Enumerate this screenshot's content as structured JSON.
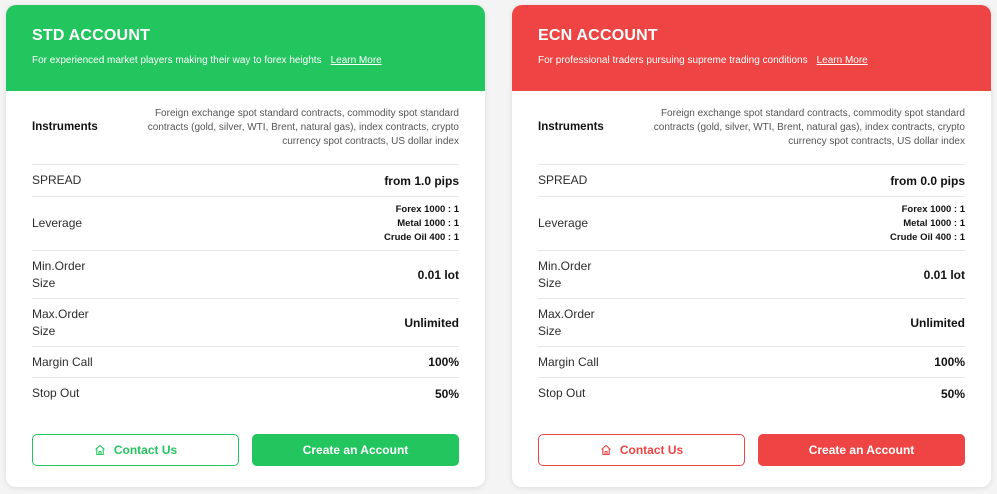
{
  "colors": {
    "std_accent": "#22c55e",
    "ecn_accent": "#ef4444"
  },
  "std": {
    "title": "STD ACCOUNT",
    "subtitle": "For experienced market players making their way to forex heights",
    "learn_more": "Learn More",
    "rows": {
      "instruments": {
        "label": "Instruments",
        "value": "Foreign exchange spot standard contracts, commodity spot standard contracts (gold, silver, WTI, Brent, natural gas), index contracts, crypto currency spot contracts, US dollar index"
      },
      "spread": {
        "label": "SPREAD",
        "value": "from 1.0 pips"
      },
      "leverage": {
        "label": "Leverage",
        "values": [
          "Forex 1000 : 1",
          "Metal 1000 : 1",
          "Crude Oil 400 : 1"
        ]
      },
      "min_order": {
        "label_1": "Min.Order",
        "label_2": "Size",
        "value": "0.01 lot"
      },
      "max_order": {
        "label_1": "Max.Order",
        "label_2": "Size",
        "value": "Unlimited"
      },
      "margin_call": {
        "label": "Margin Call",
        "value": "100%"
      },
      "stop_out": {
        "label": "Stop Out",
        "value": "50%"
      }
    },
    "contact_label": "Contact Us",
    "create_label": "Create an Account"
  },
  "ecn": {
    "title": "ECN ACCOUNT",
    "subtitle": "For professional traders pursuing supreme trading conditions",
    "learn_more": "Learn More",
    "rows": {
      "instruments": {
        "label": "Instruments",
        "value": "Foreign exchange spot standard contracts, commodity spot standard contracts (gold, silver, WTI, Brent, natural gas), index contracts, crypto currency spot contracts, US dollar index"
      },
      "spread": {
        "label": "SPREAD",
        "value": "from 0.0 pips"
      },
      "leverage": {
        "label": "Leverage",
        "values": [
          "Forex 1000 : 1",
          "Metal 1000 : 1",
          "Crude Oil 400 : 1"
        ]
      },
      "min_order": {
        "label_1": "Min.Order",
        "label_2": "Size",
        "value": "0.01 lot"
      },
      "max_order": {
        "label_1": "Max.Order",
        "label_2": "Size",
        "value": "Unlimited"
      },
      "margin_call": {
        "label": "Margin Call",
        "value": "100%"
      },
      "stop_out": {
        "label": "Stop Out",
        "value": "50%"
      }
    },
    "contact_label": "Contact Us",
    "create_label": "Create an Account"
  }
}
